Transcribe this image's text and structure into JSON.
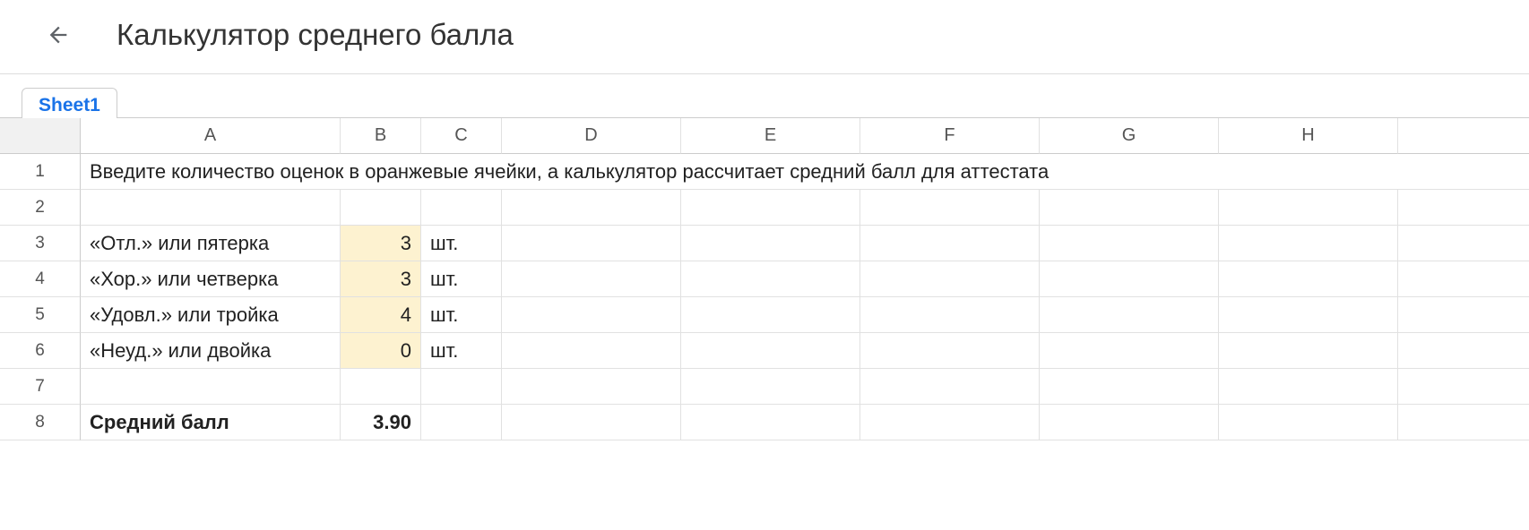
{
  "header": {
    "title": "Калькулятор среднего балла"
  },
  "tabs": {
    "active": "Sheet1"
  },
  "columns": [
    "A",
    "B",
    "C",
    "D",
    "E",
    "F",
    "G",
    "H"
  ],
  "rows": [
    "1",
    "2",
    "3",
    "4",
    "5",
    "6",
    "7",
    "8"
  ],
  "cells": {
    "instruction": "Введите количество оценок в оранжевые ячейки, а калькулятор рассчитает средний балл для аттестата",
    "a3": "«Отл.» или пятерка",
    "b3": "3",
    "c3": "шт.",
    "a4": "«Хор.» или четверка",
    "b4": "3",
    "c4": "шт.",
    "a5": "«Удовл.» или тройка",
    "b5": "4",
    "c5": "шт.",
    "a6": "«Неуд.» или двойка",
    "b6": "0",
    "c6": "шт.",
    "a8": "Средний балл",
    "b8": "3.90"
  }
}
